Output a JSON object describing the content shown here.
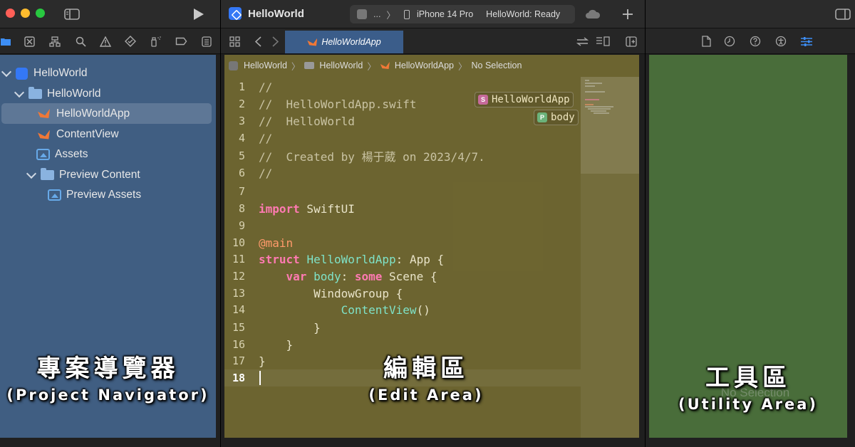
{
  "toolbar": {
    "project_title": "HelloWorld",
    "scheme_dots": "...",
    "scheme_chevron": "〉",
    "device": "iPhone 14 Pro",
    "status": "HelloWorld: Ready"
  },
  "editor_tab": {
    "label": "HelloWorldApp"
  },
  "breadcrumb": {
    "items": [
      "HelloWorld",
      "HelloWorld",
      "HelloWorldApp",
      "No Selection"
    ]
  },
  "navigator": {
    "items": [
      {
        "label": "HelloWorld",
        "kind": "project"
      },
      {
        "label": "HelloWorld",
        "kind": "folder"
      },
      {
        "label": "HelloWorldApp",
        "kind": "swift-file",
        "selected": true
      },
      {
        "label": "ContentView",
        "kind": "swift-file"
      },
      {
        "label": "Assets",
        "kind": "asset-catalog"
      },
      {
        "label": "Preview Content",
        "kind": "folder"
      },
      {
        "label": "Preview Assets",
        "kind": "asset-catalog"
      }
    ]
  },
  "code": {
    "line_numbers": [
      "1",
      "2",
      "3",
      "4",
      "5",
      "6",
      "7",
      "8",
      "9",
      "10",
      "11",
      "12",
      "13",
      "14",
      "15",
      "16",
      "17",
      "18"
    ],
    "lines": [
      [
        "//"
      ],
      [
        "//  HelloWorldApp.swift"
      ],
      [
        "//  HelloWorld"
      ],
      [
        "//"
      ],
      [
        "//  Created by 楊于葳 on 2023/4/7."
      ],
      [
        "//"
      ],
      [
        ""
      ],
      [
        "import",
        " SwiftUI"
      ],
      [
        ""
      ],
      [
        "@main"
      ],
      [
        "struct",
        " ",
        "HelloWorldApp",
        ": App {"
      ],
      [
        "    ",
        "var",
        " ",
        "body",
        ": ",
        "some",
        " Scene {"
      ],
      [
        "        WindowGroup {"
      ],
      [
        "            ",
        "ContentView",
        "()"
      ],
      [
        "        }"
      ],
      [
        "    }"
      ],
      [
        "}"
      ],
      [
        ""
      ]
    ]
  },
  "doc_chips": [
    {
      "badge": "S",
      "label": "HelloWorldApp",
      "color": "#c66a9a"
    },
    {
      "badge": "P",
      "label": "body",
      "color": "#6bb27a"
    }
  ],
  "utility": {
    "no_selection": "No Selection"
  },
  "labels": {
    "navigator_zh": "專案導覽器",
    "navigator_en": "(Project Navigator)",
    "editor_zh": "編輯區",
    "editor_en": "(Edit Area)",
    "utility_zh": "工具區",
    "utility_en": "(Utility Area)"
  },
  "colors": {
    "navigator_overlay": "#4c76a8",
    "editor_overlay": "#807634",
    "utility_overlay": "#496d3a",
    "selected_tab": "#3b5d8a",
    "swift_orange": "#f07837"
  }
}
